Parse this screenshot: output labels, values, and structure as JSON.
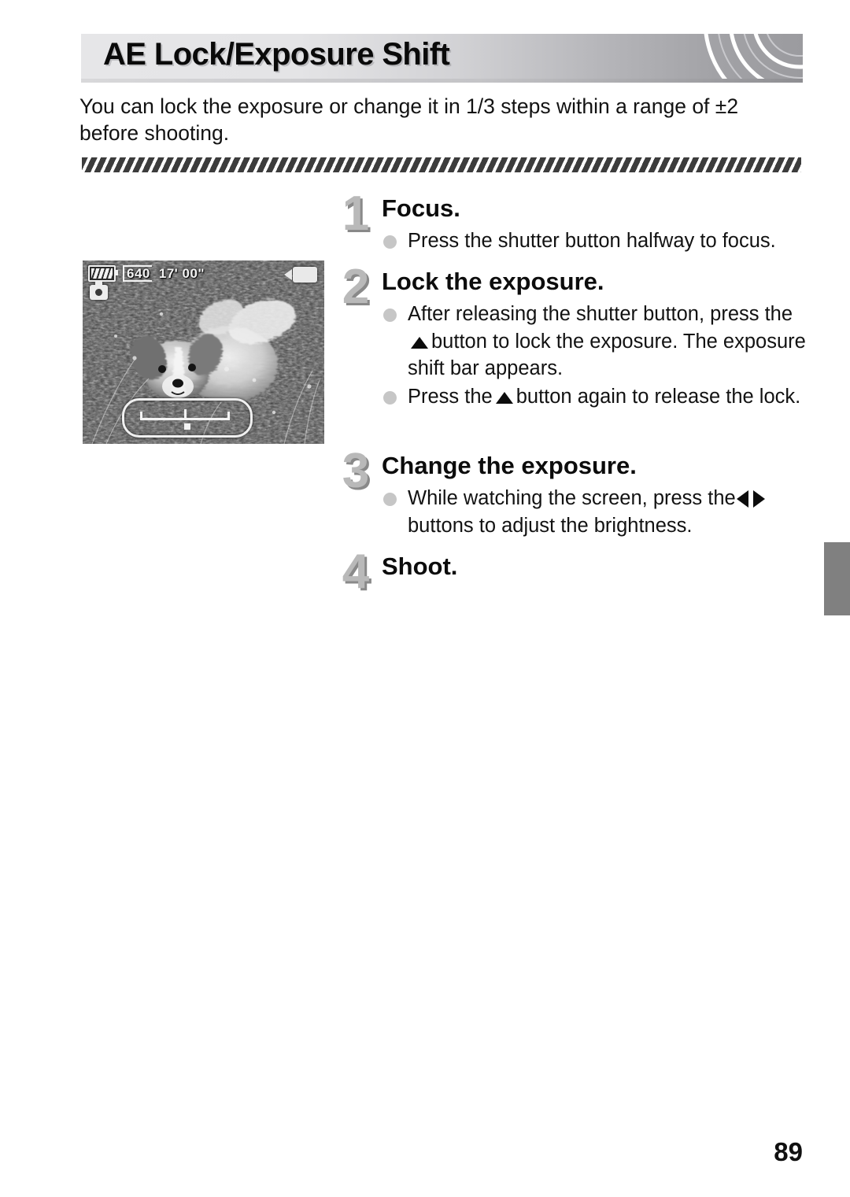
{
  "page": {
    "number": "89",
    "title": "AE Lock/Exposure Shift",
    "intro": "You can lock the exposure or change it in 1/3 steps within a range of ±2 before shooting."
  },
  "lcd_screenshot": {
    "scene_description": "Papillon dog sitting in grass and weeds",
    "battery_icon": "battery-full-icon",
    "resolution": "640",
    "time_remaining": "17' 00\"",
    "mode_icon": "camera-mode-icon",
    "movie_icon": "movie-camera-icon",
    "exposure_shift_bar": "exposure-shift-bar"
  },
  "steps": [
    {
      "number": "1",
      "heading": "Focus.",
      "bullets": [
        {
          "parts": [
            {
              "text": "Press the shutter button halfway to focus."
            }
          ]
        }
      ]
    },
    {
      "number": "2",
      "heading": "Lock the exposure.",
      "bullets": [
        {
          "parts": [
            {
              "text": "After releasing the shutter button, press the"
            },
            {
              "glyph": "up-button-icon"
            },
            {
              "text": "button to lock the exposure. The exposure shift bar appears."
            }
          ]
        },
        {
          "parts": [
            {
              "text": "Press the"
            },
            {
              "glyph": "up-button-icon"
            },
            {
              "text": "button again to release the lock."
            }
          ]
        }
      ]
    },
    {
      "number": "3",
      "heading": "Change the exposure.",
      "bullets": [
        {
          "parts": [
            {
              "text": "While watching the screen, press the"
            },
            {
              "glyph": "left-right-buttons-icon"
            },
            {
              "text": "buttons to adjust the brightness."
            }
          ]
        }
      ]
    },
    {
      "number": "4",
      "heading": "Shoot.",
      "bullets": []
    }
  ],
  "colors": {
    "banner_light": "#e6e6e8",
    "banner_dark": "#9b9b9f",
    "step_number": "#b9b9b9",
    "bullet_dot": "#c6c6c6",
    "chapter_tab": "#808080",
    "text": "#121212"
  }
}
